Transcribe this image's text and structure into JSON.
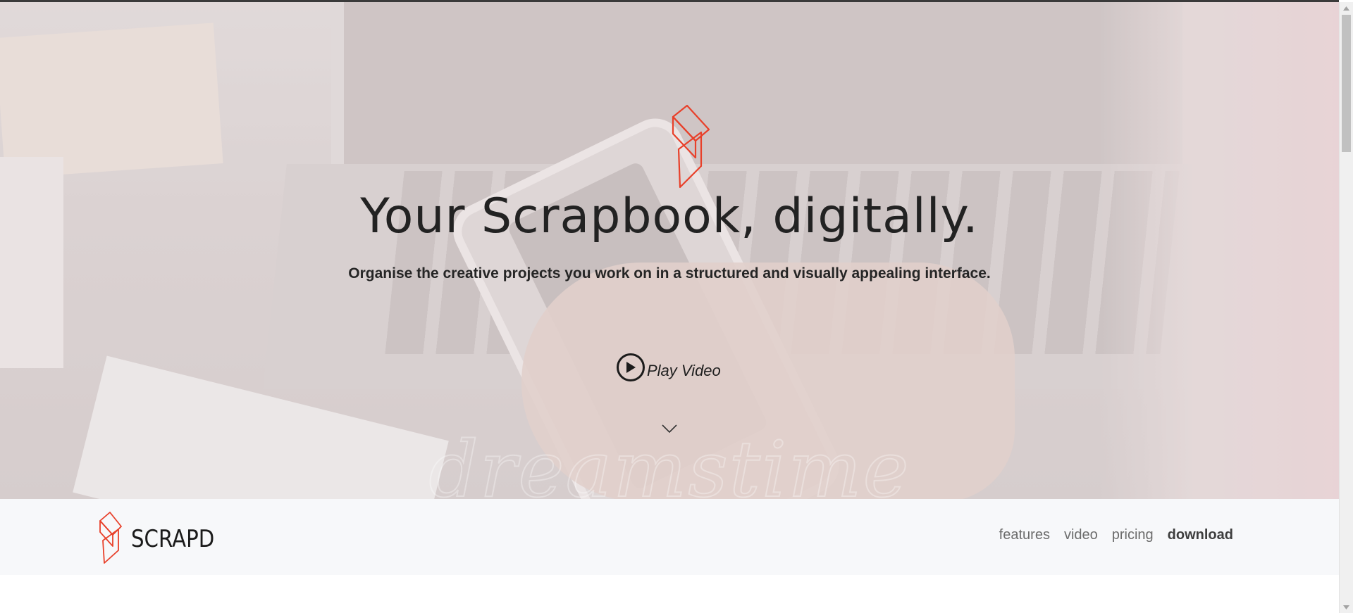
{
  "hero": {
    "title": "Your Scrapbook, digitally.",
    "subtitle": "Organise the creative projects you work on in a structured and visually appealing interface.",
    "play_label": "Play Video",
    "watermark": "dreamstime"
  },
  "navbar": {
    "brand": "SCRAPD",
    "links": [
      {
        "label": "features"
      },
      {
        "label": "video"
      },
      {
        "label": "pricing"
      },
      {
        "label": "download"
      }
    ]
  },
  "colors": {
    "brand_red": "#e8402a",
    "text_dark": "#222222",
    "nav_text": "#6b6b6b",
    "navbar_bg": "#f7f8fa"
  },
  "icons": {
    "hero_logo": "scrapd-logo-icon",
    "play": "play-icon",
    "scroll": "chevron-down-icon"
  }
}
